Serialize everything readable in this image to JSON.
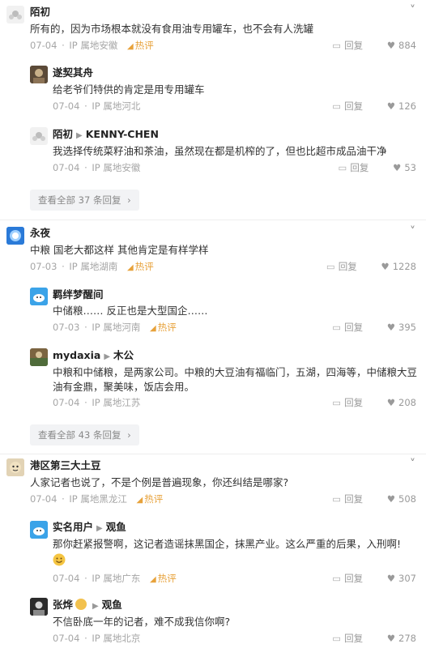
{
  "threads": [
    {
      "comment": {
        "user": "陌初",
        "text": "所有的，因为市场根本就没有食用油专用罐车，也不会有人洗罐",
        "date": "07-04",
        "location": "IP 属地安徽",
        "hot": "热评",
        "reply_label": "回复",
        "likes": "884"
      },
      "replies": [
        {
          "user": "遂契其舟",
          "text": "给老爷们特供的肯定是用专用罐车",
          "date": "07-04",
          "location": "IP 属地河北",
          "reply_label": "回复",
          "likes": "126"
        },
        {
          "user": "陌初",
          "reply_to": "KENNY-CHEN",
          "text": "我选择传统菜籽油和茶油，虽然现在都是机榨的了，但也比超市成品油干净",
          "date": "07-04",
          "location": "IP 属地安徽",
          "reply_label": "回复",
          "likes": "53"
        }
      ],
      "view_all": "查看全部 37 条回复"
    },
    {
      "comment": {
        "user": "永夜",
        "text": "中粮 国老大都这样 其他肯定是有样学样",
        "date": "07-03",
        "location": "IP 属地湖南",
        "hot": "热评",
        "reply_label": "回复",
        "likes": "1228"
      },
      "replies": [
        {
          "user": "羁绊梦醒间",
          "text": "中储粮…… 反正也是大型国企……",
          "date": "07-03",
          "location": "IP 属地河南",
          "hot": "热评",
          "reply_label": "回复",
          "likes": "395"
        },
        {
          "user": "mydaxia",
          "reply_to": "木公",
          "text": "中粮和中储粮，是两家公司。中粮的大豆油有福临门，五湖，四海等，中储粮大豆",
          "text2": "油有金鼎，聚美味，饭店会用。",
          "date": "07-04",
          "location": "IP 属地江苏",
          "reply_label": "回复",
          "likes": "208"
        }
      ],
      "view_all": "查看全部 43 条回复"
    },
    {
      "comment": {
        "user": "港区第三大土豆",
        "text": "人家记者也说了，不是个例是普遍现象，你还纠结是哪家?",
        "date": "07-04",
        "location": "IP 属地黑龙江",
        "hot": "热评",
        "reply_label": "回复",
        "likes": "508"
      },
      "replies": [
        {
          "user": "实名用户",
          "reply_to": "观鱼",
          "text": "那你赶紧报警啊，这记者造谣抹黑国企，抹黑产业。这么严重的后果，入刑啊!",
          "date": "07-04",
          "location": "IP 属地广东",
          "hot": "热评",
          "reply_label": "回复",
          "likes": "307"
        },
        {
          "user": "张烨",
          "reply_to": "观鱼",
          "text": "不信卧底一年的记者，难不成我信你啊?",
          "date": "07-04",
          "location": "IP 属地北京",
          "reply_label": "回复",
          "likes": "278"
        }
      ]
    }
  ],
  "colors": {
    "hot": "#e7a23b",
    "meta": "#a6a6a6",
    "view_all_bg": "#f2f3f5"
  }
}
